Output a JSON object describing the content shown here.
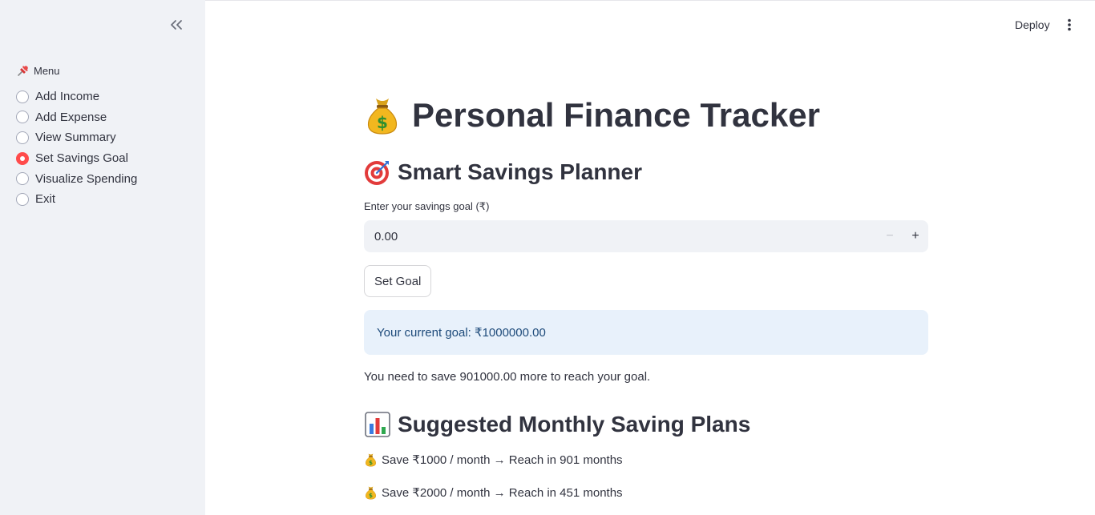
{
  "sidebar": {
    "menu_title": "Menu",
    "items": [
      {
        "label": "Add Income",
        "selected": false
      },
      {
        "label": "Add Expense",
        "selected": false
      },
      {
        "label": "View Summary",
        "selected": false
      },
      {
        "label": "Set Savings Goal",
        "selected": true
      },
      {
        "label": "Visualize Spending",
        "selected": false
      },
      {
        "label": "Exit",
        "selected": false
      }
    ],
    "accent_color": "#ff4b4b"
  },
  "header": {
    "deploy_label": "Deploy"
  },
  "main": {
    "title": "Personal Finance Tracker",
    "section_title": "Smart Savings Planner",
    "goal_input": {
      "label": "Enter your savings goal (₹)",
      "value": "0.00",
      "minus": "−",
      "plus": "+"
    },
    "set_goal_label": "Set Goal",
    "info_message": "Your current goal: ₹1000000.00",
    "need_message": "You need to save 901000.00 more to reach your goal.",
    "plans_title": "Suggested Monthly Saving Plans",
    "plans": [
      "Save ₹1000 / month → Reach in 901 months",
      "Save ₹2000 / month → Reach in 451 months"
    ]
  },
  "icons": [
    "collapse-sidebar-icon",
    "pushpin-icon",
    "money-bag-icon",
    "target-icon",
    "bar-chart-icon",
    "more-vert-icon"
  ]
}
